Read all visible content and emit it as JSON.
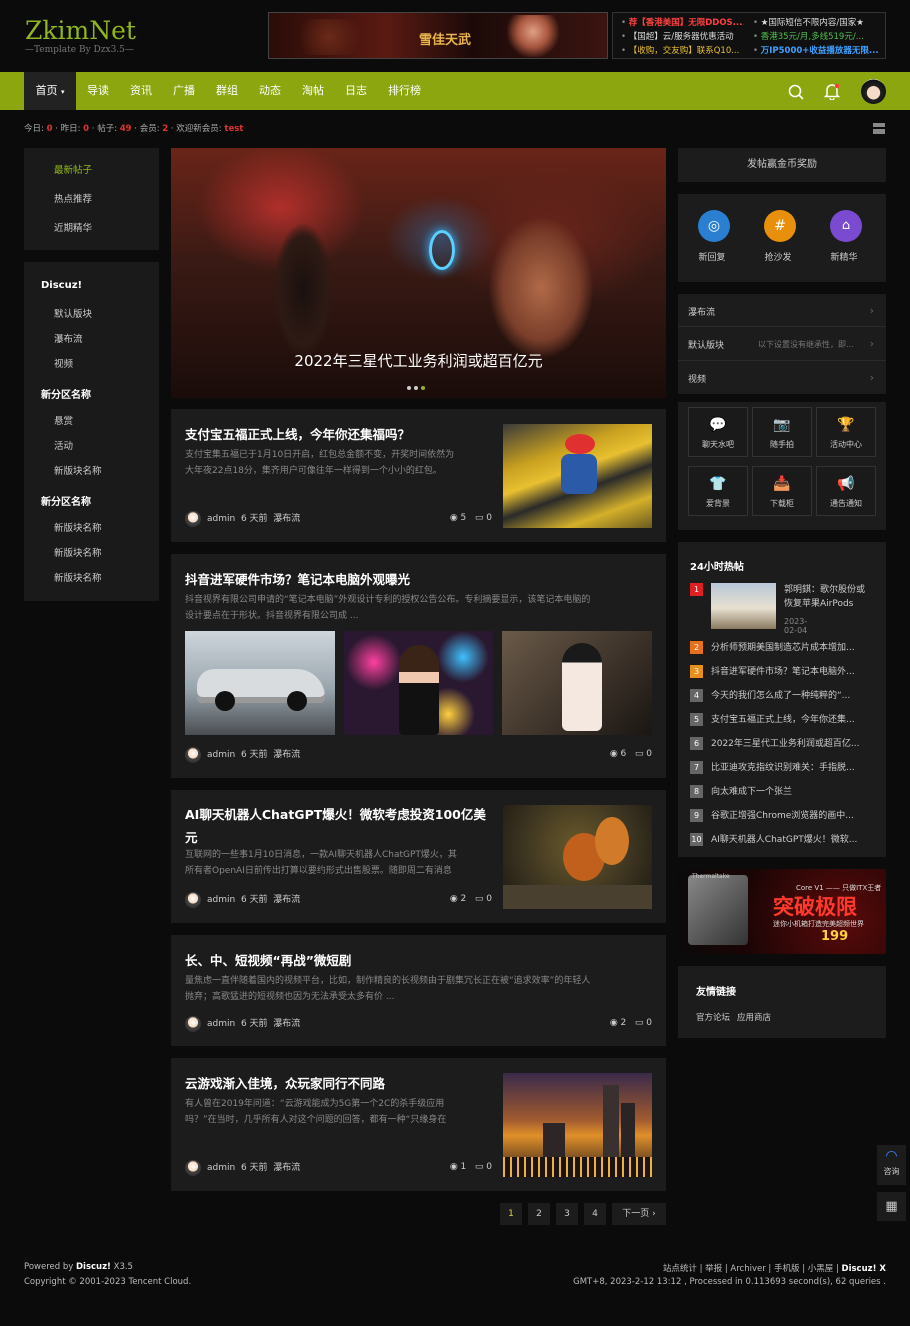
{
  "brand": {
    "name": "ZkimNet",
    "tagline": "—Template By Dzx3.5—"
  },
  "banner": {
    "title": "雪佳天武"
  },
  "ads": [
    {
      "text": "荐【香港美国】无限DDOS...",
      "color": "#ff4040"
    },
    {
      "text": "★国际短信不限内容/国家★",
      "color": "#dddddd"
    },
    {
      "text": "【国超】云/服务器优惠活动",
      "color": "#dddddd"
    },
    {
      "text": "香港35元/月,多线519元/...",
      "color": "#4ec04e"
    },
    {
      "text": "【收购，交友购】联系Q10...",
      "color": "#e8c030"
    },
    {
      "text": "万IP5000+收益播放器无限...",
      "color": "#40a0ff"
    }
  ],
  "nav": {
    "items": [
      "首页",
      "导读",
      "资讯",
      "广播",
      "群组",
      "动态",
      "淘帖",
      "日志",
      "排行榜"
    ],
    "home_caret": "▾"
  },
  "stats_bar": {
    "today_label": "今日: ",
    "today": "0",
    "yest_label": " · 昨日: ",
    "yest": "0",
    "posts_label": " · 帖子: ",
    "posts": "49",
    "members_label": " · 会员: ",
    "members": "2",
    "new_label": " · 欢迎新会员: ",
    "new_member": "test"
  },
  "left_tabs": [
    "最新帖子",
    "热点推荐",
    "近期精华"
  ],
  "forums": [
    {
      "group": "Discuz!",
      "items": [
        "默认版块",
        "瀑布流",
        "视频"
      ]
    },
    {
      "group": "新分区名称",
      "items": [
        "悬赏",
        "活动",
        "新版块名称"
      ]
    },
    {
      "group": "新分区名称",
      "items": [
        "新版块名称",
        "新版块名称",
        "新版块名称"
      ]
    }
  ],
  "slider": {
    "caption": "2022年三星代工业务利润或超百亿元"
  },
  "posts": [
    {
      "title": "支付宝五福正式上线，今年你还集福吗？",
      "desc1": "支付宝集五福已于1月10日开启，红包总金额不变，开奖时间依然为",
      "desc2": "大年夜22点18分，集齐用户可像往年一样得到一个小小的红包。",
      "author": "admin",
      "time": "6 天前",
      "forum": "瀑布流",
      "views": "5",
      "replies": "0"
    },
    {
      "title": "抖音进军硬件市场？笔记本电脑外观曝光",
      "desc1": "抖音视界有限公司申请的“笔记本电脑”外观设计专利的授权公告公布。专利摘要显示，该笔记本电脑的",
      "desc2": "设计要点在于形状。抖音视界有限公司成 ...",
      "author": "admin",
      "time": "6 天前",
      "forum": "瀑布流",
      "views": "6",
      "replies": "0"
    },
    {
      "title": "AI聊天机器人ChatGPT爆火！微软考虑投资100亿美",
      "title2": "元",
      "desc1": "互联网的一些事1月10日消息，一款AI聊天机器人ChatGPT爆火，其",
      "desc2": "所有者OpenAI日前传出打算以要约形式出售股票。随即周二有消息",
      "author": "admin",
      "time": "6 天前",
      "forum": "瀑布流",
      "views": "2",
      "replies": "0"
    },
    {
      "title": "长、中、短视频“再战”微短剧",
      "desc1": "量焦虑一直伴随着国内的视频平台，比如，制作精良的长视频由于剧集冗长正在被“追求效率”的年轻人",
      "desc2": "抛弃；高歌猛进的短视频也因为无法承受太多有价 ...",
      "author": "admin",
      "time": "6 天前",
      "forum": "瀑布流",
      "views": "2",
      "replies": "0"
    },
    {
      "title": "云游戏渐入佳境，众玩家同行不同路",
      "desc1": "有人曾在2019年问道：“云游戏能成为5G第一个2C的杀手级应用",
      "desc2": "吗？”在当时，几乎所有人对这个问题的回答，都有一种“只缘身在",
      "author": "admin",
      "time": "6 天前",
      "forum": "瀑布流",
      "views": "1",
      "replies": "0"
    }
  ],
  "sidebar": {
    "reward": "发帖赢金币奖励",
    "quick": [
      {
        "label": "新回复",
        "color": "#2b7fd0"
      },
      {
        "label": "抢沙发",
        "color": "#e8900c"
      },
      {
        "label": "新精华",
        "color": "#7a4ad0"
      }
    ],
    "links": [
      {
        "label": "瀑布流",
        "note": ""
      },
      {
        "label": "默认版块",
        "note": "以下设置没有继承性，即..."
      },
      {
        "label": "视频",
        "note": ""
      }
    ],
    "apps": [
      {
        "label": "聊天水吧",
        "icon": "💬"
      },
      {
        "label": "随手拍",
        "icon": "📷"
      },
      {
        "label": "活动中心",
        "icon": "🏆"
      },
      {
        "label": "爱背景",
        "icon": "👕"
      },
      {
        "label": "下载柜",
        "icon": "📥"
      },
      {
        "label": "通告通知",
        "icon": "📢"
      }
    ],
    "hot_title": "24小时热帖",
    "hot_first": {
      "title1": "郭明錤：歌尔股份或",
      "title2": "恢复苹果AirPods",
      "date": "2023-02-04"
    },
    "hot": [
      {
        "n": "2",
        "t": "分析师预期美国制造芯片成本增加...",
        "c": "#e8701c"
      },
      {
        "n": "3",
        "t": "抖音进军硬件市场？笔记本电脑外...",
        "c": "#e8901c"
      },
      {
        "n": "4",
        "t": "今天的我们怎么成了一种纯粹的“...",
        "c": "#666666"
      },
      {
        "n": "5",
        "t": "支付宝五福正式上线，今年你还集...",
        "c": "#666666"
      },
      {
        "n": "6",
        "t": "2022年三星代工业务利润或超百亿...",
        "c": "#666666"
      },
      {
        "n": "7",
        "t": "比亚迪攻克指纹识别难关：手指脱...",
        "c": "#666666"
      },
      {
        "n": "8",
        "t": "向太难成下一个张兰",
        "c": "#666666"
      },
      {
        "n": "9",
        "t": "谷歌正增强Chrome浏览器的画中...",
        "c": "#666666"
      },
      {
        "n": "10",
        "t": "AI聊天机器人ChatGPT爆火！微软...",
        "c": "#666666"
      }
    ],
    "ad": {
      "brand": "Thermaltake",
      "model": "Core V1 —— 只做ITX王者",
      "slogan": "突破极限",
      "sub": "迷你小机箱打造完美超频世界",
      "price": "199"
    },
    "friends_title": "友情链接",
    "friends": [
      "官方论坛",
      "应用商店"
    ]
  },
  "pager": {
    "pages": [
      "1",
      "2",
      "3",
      "4"
    ],
    "next": "下一页 ›"
  },
  "footer": {
    "powered": "Powered by ",
    "discuz": "Discuz!",
    "ver": " X3.5",
    "copy": "Copyright © 2001-2023 Tencent Cloud.",
    "links": "站点统计 | 举报 | Archiver | 手机版 | 小黑屋 | ",
    "links_b": "Discuz! X",
    "gmt": "GMT+8, 2023-2-12 13:12 , Processed in 0.113693 second(s), 62 queries ."
  },
  "fab": {
    "consult": "咨询"
  }
}
